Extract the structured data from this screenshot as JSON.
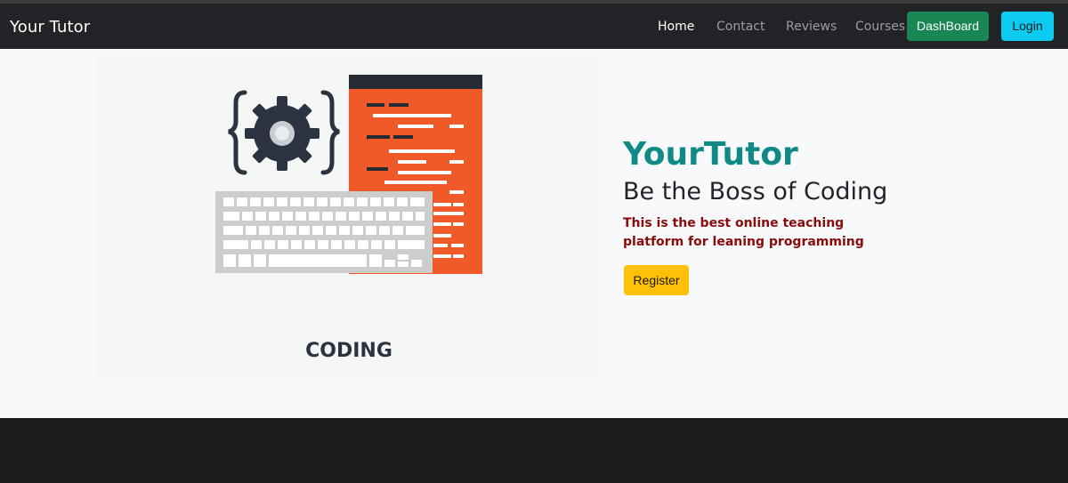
{
  "navbar": {
    "brand": "Your Tutor",
    "links": [
      {
        "label": "Home"
      },
      {
        "label": "Contact"
      },
      {
        "label": "Reviews"
      },
      {
        "label": "Courses"
      }
    ],
    "dashboard_label": "DashBoard",
    "login_label": "Login"
  },
  "hero": {
    "illustration_caption": "CODING",
    "title": "YourTutor",
    "subtitle": "Be the Boss of Coding",
    "description": "This is the best online teaching platform for leaning programming",
    "register_label": "Register"
  },
  "colors": {
    "navbar_bg": "#212327",
    "dashboard_btn": "#198754",
    "login_btn": "#0dcaf0",
    "title_teal": "#0f8a86",
    "description_red": "#8b0a0a",
    "register_btn": "#ffc107",
    "code_panel_orange": "#f05a28",
    "icon_dark": "#2b3240"
  },
  "icons": [
    "gear-icon",
    "code-braces-icon",
    "keyboard-illustration",
    "code-document-illustration"
  ]
}
